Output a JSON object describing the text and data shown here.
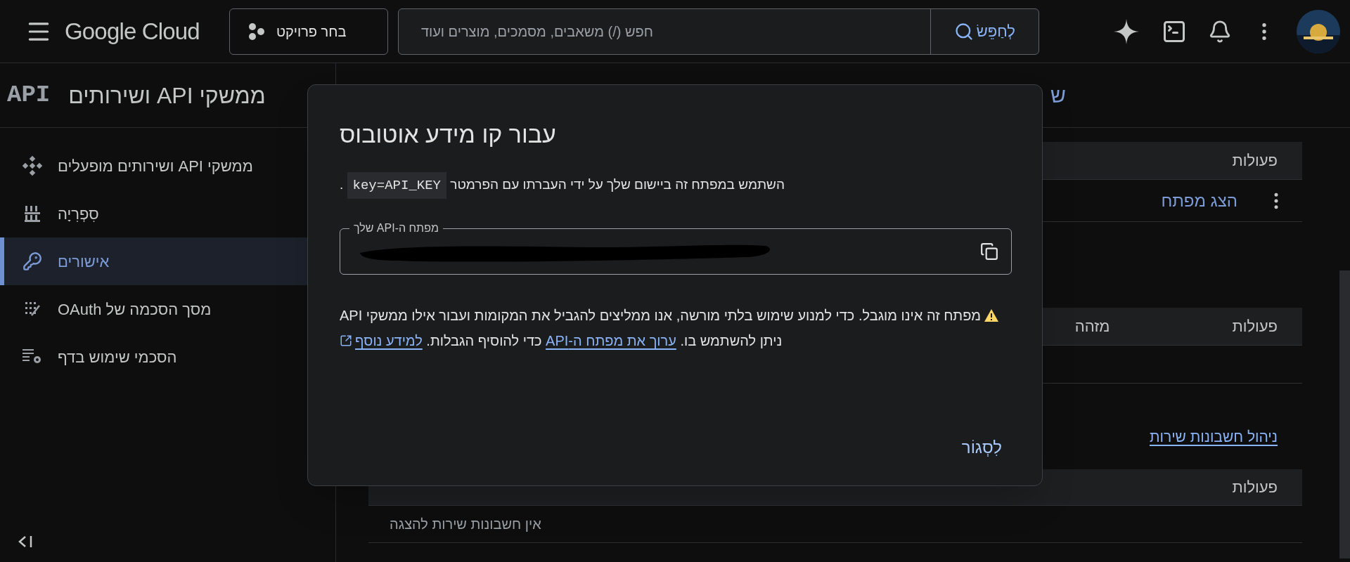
{
  "top_bar": {
    "logo": "Google Cloud",
    "project_button": "בחר פרויקט",
    "search": {
      "placeholder": "חפש (/) משאבים, מסמכים, מוצרים ועוד",
      "button": "לְחַפֵּשׂ"
    }
  },
  "sidebar": {
    "badge": "API",
    "title": "ממשקי API ושירותים",
    "items": [
      {
        "kind": "enabled",
        "label": "ממשקי API ושירותים מופעלים",
        "selected": false
      },
      {
        "kind": "library",
        "label": "סִפְרִיָה",
        "selected": false
      },
      {
        "kind": "credentials",
        "label": "אישורים",
        "selected": true
      },
      {
        "kind": "consent",
        "label": "מסך הסכמה של OAuth",
        "selected": false
      },
      {
        "kind": "agreements",
        "label": "הסכמי שימוש בדף",
        "selected": false
      }
    ]
  },
  "page": {
    "title": "ש",
    "table_1": {
      "columns": [
        "פעולות"
      ],
      "rows": [
        {
          "action": "הצג מפתח"
        }
      ]
    },
    "table_2": {
      "columns": [
        "פעולות",
        "מזהה"
      ]
    },
    "service_accounts_link": "ניהול חשבונות שירות",
    "table_3": {
      "columns": [
        "פעולות"
      ],
      "empty": "אין חשבונות שירות להצגה"
    }
  },
  "dialog": {
    "title": "עבור קו מידע אוטובוס",
    "description": {
      "text": "השתמש במפתח זה ביישום שלך על ידי העברתו עם הפרמטר ",
      "code": "key=API_KEY",
      "end": " ."
    },
    "key_field": {
      "label": "מפתח ה-API שלך"
    },
    "warning": [
      {
        "kind": "text",
        "text": "מפתח זה אינו מוגבל. כדי למנוע שימוש בלתי מורשה, אנו ממליצים להגביל את המקומות ועבור אילו ממשקי API ניתן להשתמש בו. "
      },
      {
        "kind": "link",
        "text": "ערוך את מפתח ה-API",
        "external": false
      },
      {
        "kind": "text",
        "text": " כדי להוסיף הגבלות. "
      },
      {
        "kind": "link",
        "text": "למידע נוסף",
        "external": true
      }
    ],
    "close_button": "לִסְגוֹר"
  }
}
